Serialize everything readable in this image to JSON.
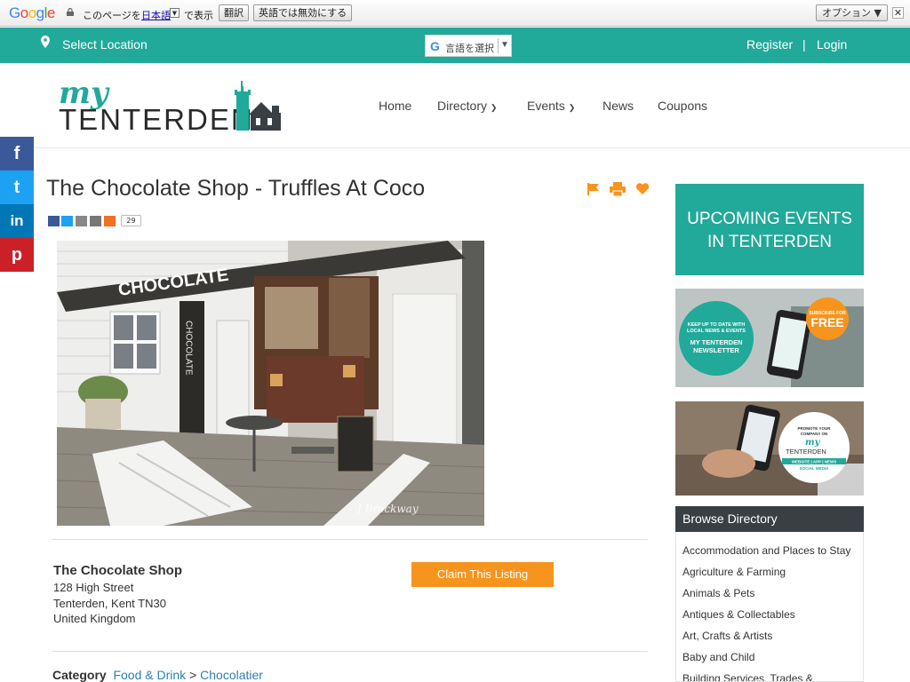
{
  "translate_bar": {
    "google_logo": "Google",
    "prefix": "このページを",
    "language": "日本語",
    "suffix": "で表示",
    "translate_button": "翻訳",
    "never_button": "英語では無効にする",
    "options_button": "オプション ▼",
    "close": "✕"
  },
  "topbar": {
    "location": "Select Location",
    "language_select": "言語を選択",
    "register": "Register",
    "separator": "|",
    "login": "Login"
  },
  "logo": {
    "top": "my",
    "bottom": "TENTERDEN"
  },
  "nav": {
    "home": "Home",
    "directory": "Directory",
    "events": "Events",
    "news": "News",
    "coupons": "Coupons"
  },
  "social": [
    "f",
    "t",
    "in",
    "p"
  ],
  "listing": {
    "title": "The Chocolate Shop - Truffles At Coco",
    "share_count": "29",
    "photo_awning": "CHOCOLATE",
    "photo_sign": "CHOCOLATE",
    "photo_credit": "J Brockway",
    "business_name": "The Chocolate Shop",
    "address_lines": [
      "128 High Street",
      "Tenterden, Kent TN30",
      "United Kingdom"
    ],
    "claim_button": "Claim This Listing",
    "category_label": "Category",
    "category_1": "Food & Drink",
    "category_sep": ">",
    "category_2": "Chocolatier"
  },
  "sidebar": {
    "events_banner_line1": "UPCOMING EVENTS",
    "events_banner_line2": "IN TENTERDEN",
    "newsletter": {
      "line1": "KEEP UP TO DATE WITH",
      "line2": "LOCAL NEWS & EVENTS",
      "line3": "MY TENTERDEN",
      "line4": "NEWSLETTER",
      "badge_small": "SUBSCRIBE FOR",
      "badge_big": "FREE"
    },
    "promote": {
      "line1": "PROMOTE YOUR",
      "line2": "COMPANY ON",
      "logo_my": "my",
      "logo_town": "TENTERDEN",
      "line3": "WEBSITE | APP | NEWS",
      "line4": "SOCIAL MEDIA"
    },
    "browse_title": "Browse Directory",
    "browse_items": [
      "Accommodation and Places to Stay",
      "Agriculture & Farming",
      "Animals & Pets",
      "Antiques & Collectables",
      "Art, Crafts & Artists",
      "Baby and Child",
      "Building Services, Trades &"
    ]
  },
  "colors": {
    "teal": "#21a99a",
    "orange": "#f7941d",
    "dark": "#3a3f44"
  }
}
